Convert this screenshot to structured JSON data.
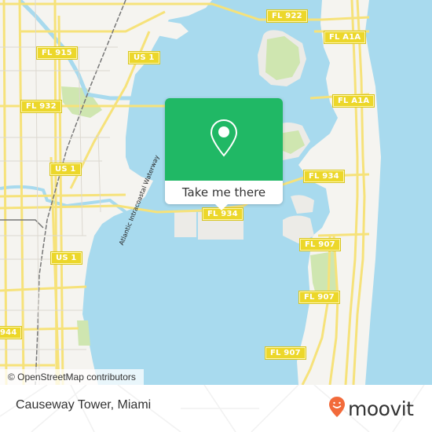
{
  "map": {
    "road_shields": [
      {
        "label": "FL 922",
        "id": "fl922"
      },
      {
        "label": "FL A1A",
        "id": "fla1a-north"
      },
      {
        "label": "FL 915",
        "id": "fl915"
      },
      {
        "label": "US 1",
        "id": "us1-north"
      },
      {
        "label": "FL A1A",
        "id": "fla1a-mid"
      },
      {
        "label": "FL 932",
        "id": "fl932"
      },
      {
        "label": "US 1",
        "id": "us1-mid"
      },
      {
        "label": "FL 934",
        "id": "fl934-east"
      },
      {
        "label": "FL 934",
        "id": "fl934-center"
      },
      {
        "label": "US 1",
        "id": "us1-south"
      },
      {
        "label": "FL 907",
        "id": "fl907-north"
      },
      {
        "label": "FL 907",
        "id": "fl907-mid"
      },
      {
        "label": "FL 907",
        "id": "fl907-south"
      },
      {
        "label": "944",
        "id": "fl944"
      }
    ],
    "waterway_label": "Atlantic Intracoastal Waterway",
    "colors": {
      "water": "#a8daee",
      "land": "#f5f4f0",
      "park": "#cfe6b0",
      "road": "#f6e27a",
      "shield": "#ecd72a"
    }
  },
  "popup": {
    "icon": "map-pin-icon",
    "action_label": "Take me there",
    "color": "#20b865"
  },
  "attribution": "© OpenStreetMap contributors",
  "footer": {
    "place_name": "Causeway Tower, Miami",
    "brand": "moovit",
    "brand_color": "#f26a3a"
  }
}
